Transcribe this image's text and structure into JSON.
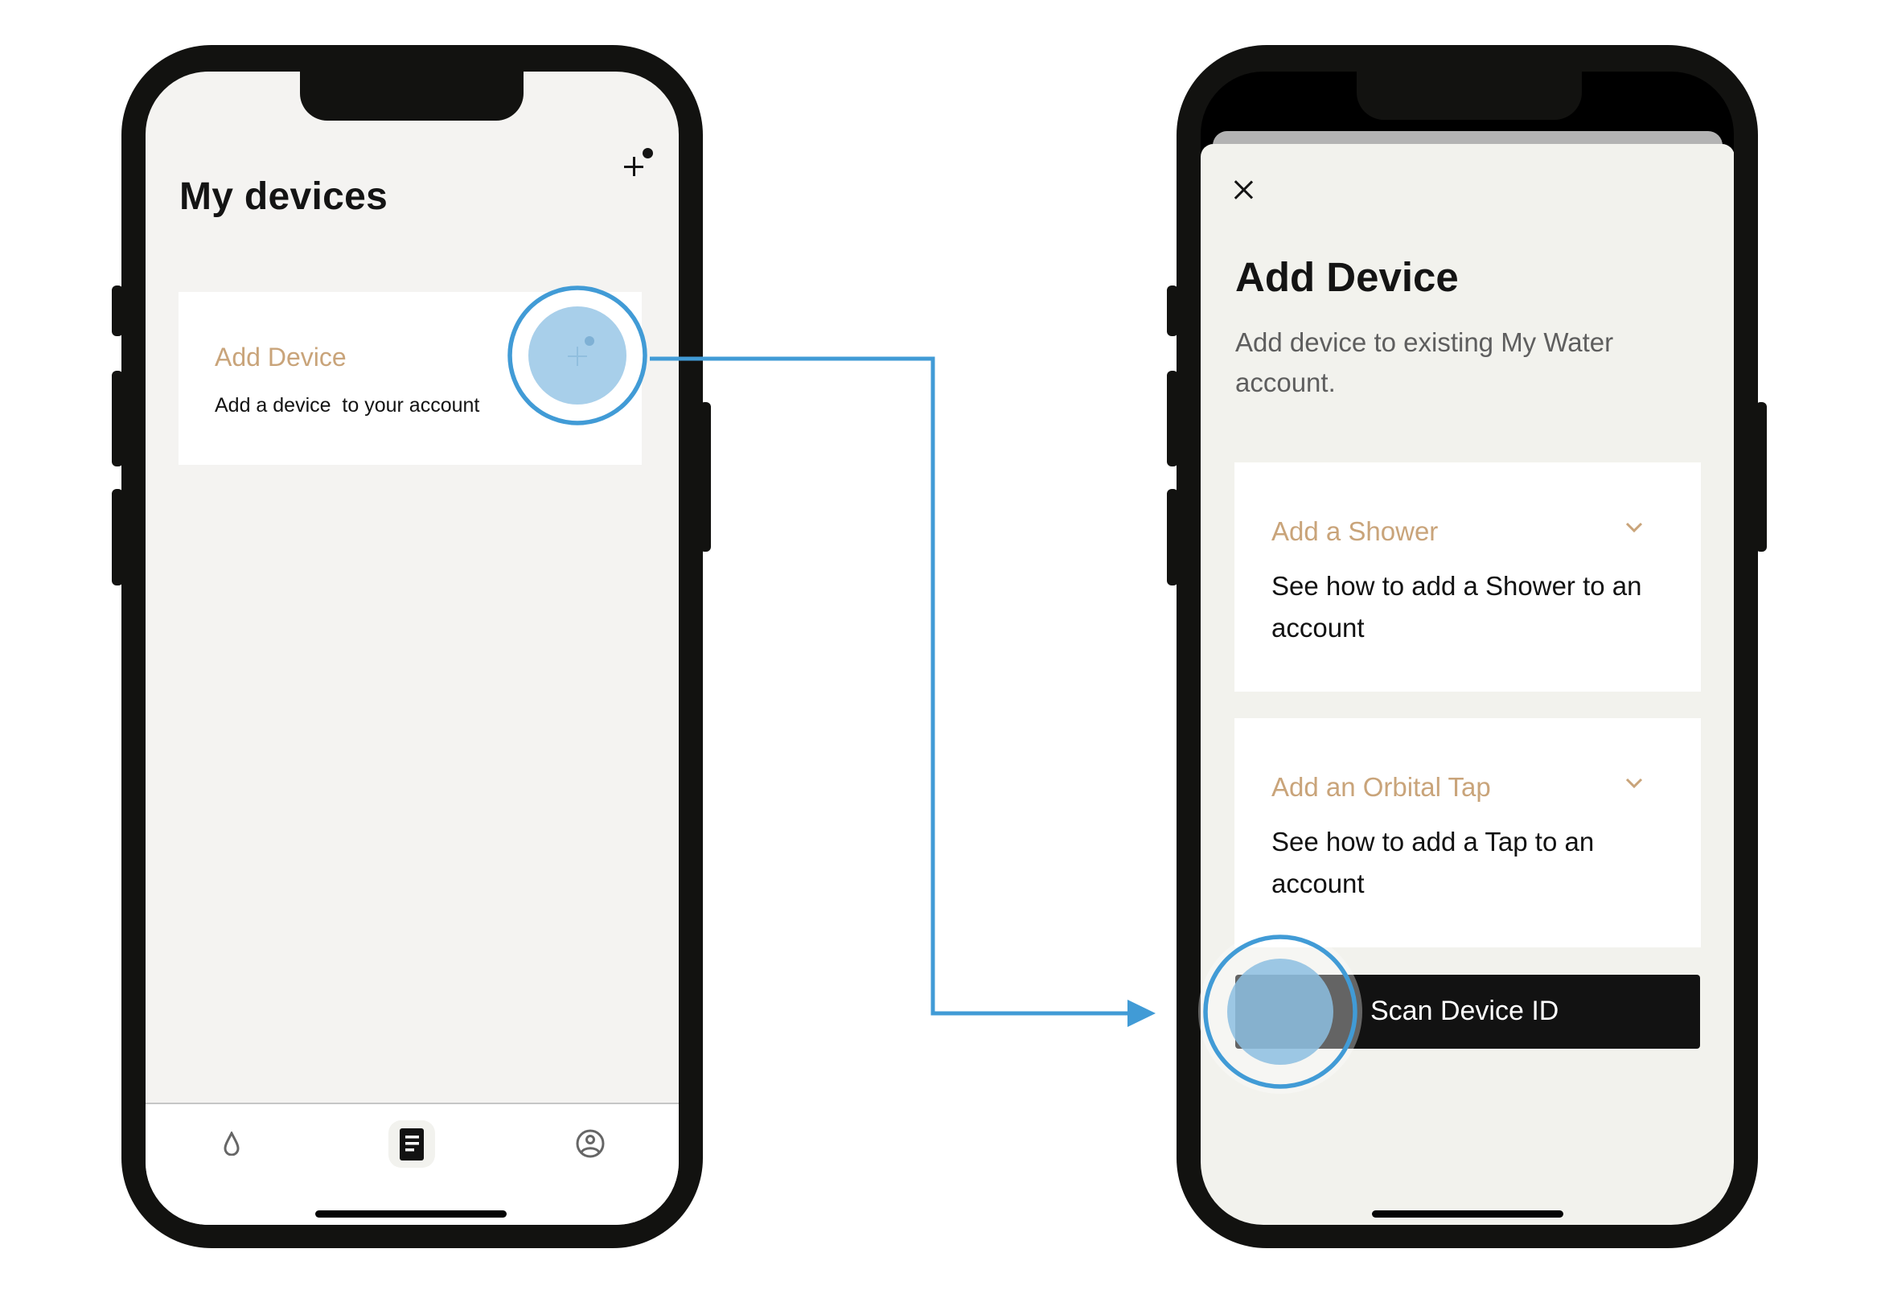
{
  "colors": {
    "accent_gold": "#C9A47A",
    "annotation_blue": "#419BD6",
    "tap_fill": "#A8CFEA",
    "phone_frame": "#121210",
    "button_dark": "#121212"
  },
  "left_screen": {
    "title": "My devices",
    "header_action_icon": "add-icon",
    "card": {
      "title": "Add Device",
      "description": "Add a device  to your account"
    },
    "bottom_nav": [
      {
        "icon": "water-drop-icon",
        "active": false
      },
      {
        "icon": "document-list-icon",
        "active": true
      },
      {
        "icon": "profile-icon",
        "active": false
      }
    ]
  },
  "right_screen": {
    "close_icon": "close-icon",
    "title": "Add Device",
    "subtitle": "Add device to existing My Water account.",
    "options": [
      {
        "title": "Add a Shower",
        "description": "See how to add a Shower to an account",
        "icon": "chevron-down-icon"
      },
      {
        "title": "Add an Orbital Tap",
        "description": "See how to add a Tap to an account",
        "icon": "chevron-down-icon"
      }
    ],
    "primary_button": "Scan Device ID"
  },
  "annotations": {
    "tap_indicators": [
      "left-add-device-plus",
      "right-scan-device-id-button"
    ],
    "flow_arrow": "from Add Device (My devices) to Scan Device ID (Add Device sheet)"
  }
}
